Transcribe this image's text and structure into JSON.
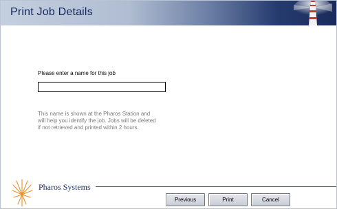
{
  "header": {
    "title": "Print Job Details",
    "icon": "lighthouse-icon"
  },
  "form": {
    "prompt_label": "Please enter a name for this job",
    "job_name_value": "",
    "help_text": "This name is shown at the Pharos Station and will help you identify the job. Jobs will be deleted if not retrieved and printed within 2 hours."
  },
  "footer": {
    "logo_text": "Pharos Systems",
    "logo_icon": "sunburst-icon",
    "buttons": {
      "previous": "Previous",
      "print": "Print",
      "cancel": "Cancel"
    }
  },
  "colors": {
    "title_text": "#13255a",
    "banner_dark": "#1a2a5a",
    "banner_light": "#c4cfdf",
    "logo_orange": "#e8932a",
    "help_text": "#7a7a7a"
  }
}
